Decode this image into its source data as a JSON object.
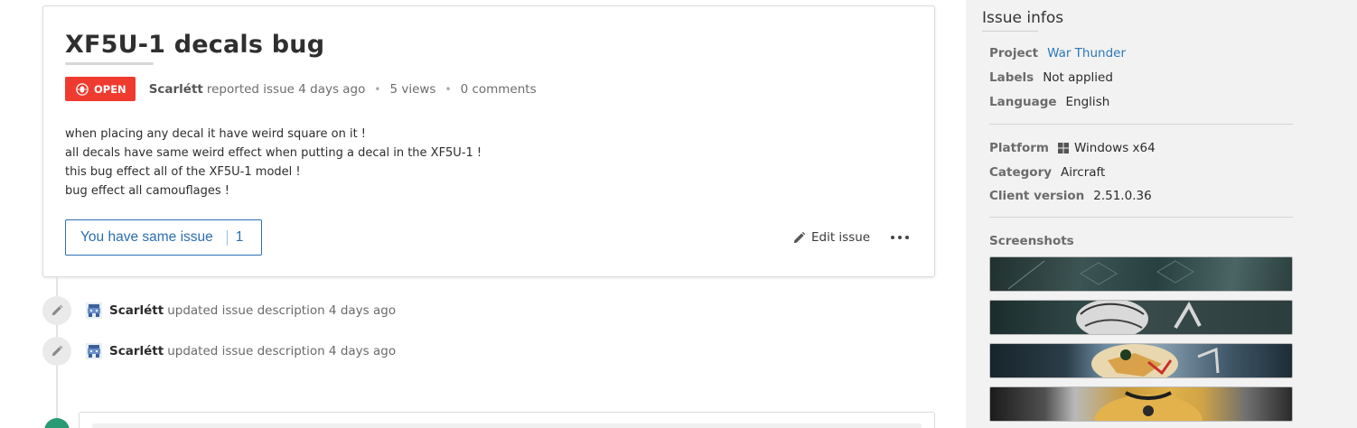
{
  "issue": {
    "title": "XF5U-1 decals bug",
    "status": "OPEN",
    "author": "Scarlétt",
    "reported_text": "reported issue 4 days ago",
    "views": "5 views",
    "comments": "0 comments",
    "description": [
      "when placing any decal it have weird square on it !",
      "all decals have same weird effect when putting a decal in the XF5U-1 !",
      "this bug effect all of the XF5U-1 model !",
      "bug effect all camouflages !"
    ],
    "same_issue_label": "You have same issue",
    "same_issue_count": "1",
    "edit_label": "Edit issue"
  },
  "timeline": [
    {
      "author": "Scarlétt",
      "text": "updated issue description 4 days ago"
    },
    {
      "author": "Scarlétt",
      "text": "updated issue description 4 days ago"
    }
  ],
  "sidebar": {
    "title": "Issue infos",
    "project_label": "Project",
    "project_value": "War Thunder",
    "labels_label": "Labels",
    "labels_value": "Not applied",
    "language_label": "Language",
    "language_value": "English",
    "platform_label": "Platform",
    "platform_value": "Windows x64",
    "category_label": "Category",
    "category_value": "Aircraft",
    "client_version_label": "Client version",
    "client_version_value": "2.51.0.36",
    "screenshots_label": "Screenshots"
  },
  "colors": {
    "status_open": "#ef3b2f",
    "accent_blue": "#2b6fb4",
    "link_blue": "#2b78b8"
  },
  "icons": [
    "bug-icon",
    "pencil-icon",
    "more-icon",
    "windows-icon",
    "avatar"
  ]
}
